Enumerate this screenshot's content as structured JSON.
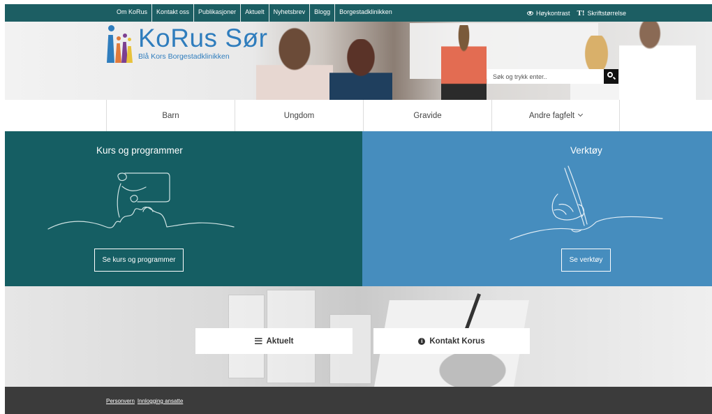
{
  "topbar": {
    "links": [
      "Om KoRus",
      "Kontakt oss",
      "Publikasjoner",
      "Aktuelt",
      "Nyhetsbrev",
      "Blogg",
      "Borgestadklinikken"
    ],
    "high_contrast_label": "Høykontrast",
    "font_size_icon_label": "T!",
    "font_size_label": "Skriftstørrelse"
  },
  "logo": {
    "title": "KoRus Sør",
    "subtitle": "Blå Kors Borgestadklinikken"
  },
  "search": {
    "placeholder": "Søk og trykk enter.."
  },
  "mainnav": {
    "items": [
      "Barn",
      "Ungdom",
      "Gravide",
      "Andre fagfelt"
    ]
  },
  "cards": {
    "courses": {
      "title": "Kurs og programmer",
      "button_label": "Se kurs og programmer"
    },
    "tools": {
      "title": "Verktøy",
      "button_label": "Se verktøy"
    }
  },
  "quicklinks": {
    "news_label": "Aktuelt",
    "contact_label": "Kontakt Korus"
  },
  "footer": {
    "privacy_label": "Personvern",
    "staff_login_label": "Innlogging ansatte"
  },
  "colors": {
    "teal": "#1c5e63",
    "card_teal": "#155e63",
    "card_blue": "#468dbe",
    "logo_blue": "#2f7dbd",
    "footer": "#3b3b3b"
  },
  "icons": [
    "eye-icon",
    "text-size-icon",
    "search-icon",
    "chevron-down-icon",
    "list-icon",
    "info-icon",
    "logo-figures-icon",
    "teacher-illustration-icon",
    "writing-hand-illustration-icon"
  ]
}
